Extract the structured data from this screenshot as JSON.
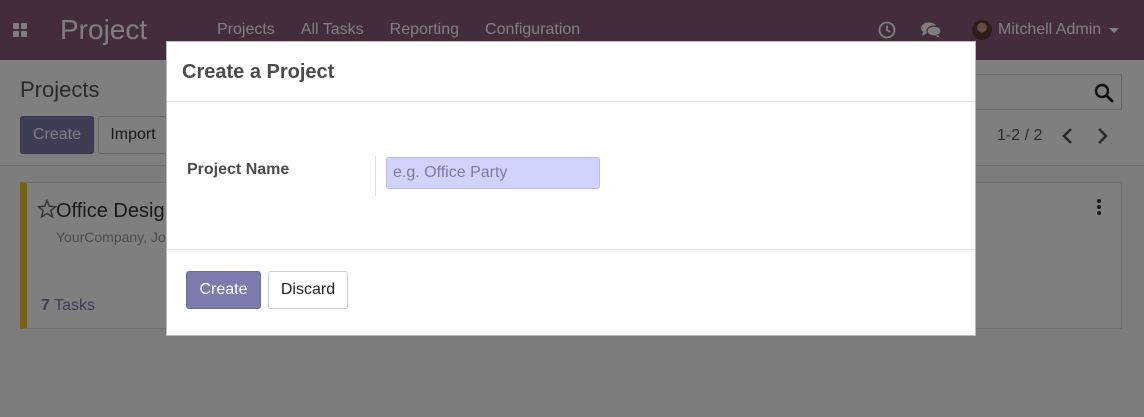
{
  "navbar": {
    "app_title": "Project",
    "menu_items": [
      "Projects",
      "All Tasks",
      "Reporting",
      "Configuration"
    ],
    "user_name": "Mitchell Admin",
    "icons": [
      "apps-grid-icon",
      "clock-icon",
      "chat-icon",
      "caret-down-icon"
    ]
  },
  "control_panel": {
    "title": "Projects",
    "create_label": "Create",
    "import_label": "Import",
    "pager": "1-2 / 2"
  },
  "kanban": {
    "cards": [
      {
        "title": "Office Design",
        "subtitle": "YourCompany, Jo",
        "task_count": "7",
        "task_label": " Tasks",
        "color": "#f0c419"
      }
    ]
  },
  "dialog": {
    "title": "Create a Project",
    "field_label": "Project Name",
    "field_placeholder": "e.g. Office Party",
    "field_value": "",
    "create_label": "Create",
    "discard_label": "Discard"
  },
  "colors": {
    "navbar": "#875a7b",
    "primary": "#7c7bad",
    "required_field": "#d2d2ff"
  }
}
